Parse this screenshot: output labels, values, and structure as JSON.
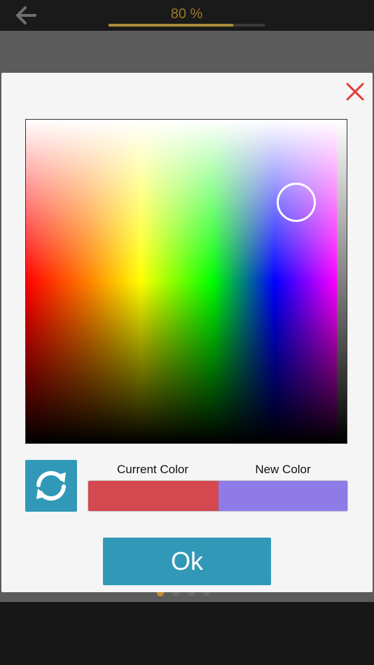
{
  "header": {
    "progress_text": "80 %",
    "progress_fraction": 0.8,
    "back_icon": "arrow-left-icon",
    "accent_color": "#a98d3a"
  },
  "dialog": {
    "close_icon": "close-x-icon",
    "close_color": "#e53935",
    "swap_icon": "refresh-swap-icon",
    "current_label": "Current Color",
    "new_label": "New Color",
    "current_color": "#d4494f",
    "new_color": "#8e7be8",
    "ok_label": "Ok",
    "button_color": "#3199b7"
  },
  "pager": {
    "count": 4,
    "active_index": 0
  }
}
